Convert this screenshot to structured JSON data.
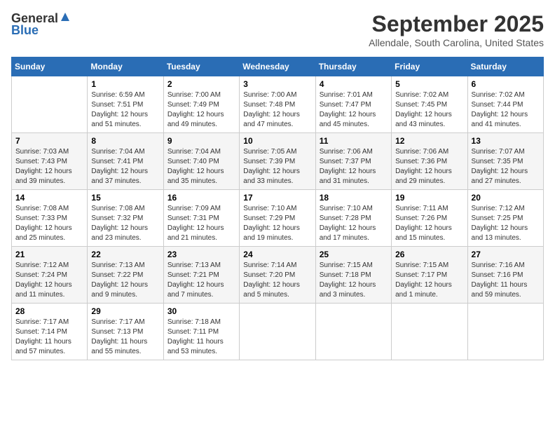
{
  "header": {
    "logo_general": "General",
    "logo_blue": "Blue",
    "month": "September 2025",
    "location": "Allendale, South Carolina, United States"
  },
  "weekdays": [
    "Sunday",
    "Monday",
    "Tuesday",
    "Wednesday",
    "Thursday",
    "Friday",
    "Saturday"
  ],
  "weeks": [
    [
      {
        "day": "",
        "info": ""
      },
      {
        "day": "1",
        "info": "Sunrise: 6:59 AM\nSunset: 7:51 PM\nDaylight: 12 hours\nand 51 minutes."
      },
      {
        "day": "2",
        "info": "Sunrise: 7:00 AM\nSunset: 7:49 PM\nDaylight: 12 hours\nand 49 minutes."
      },
      {
        "day": "3",
        "info": "Sunrise: 7:00 AM\nSunset: 7:48 PM\nDaylight: 12 hours\nand 47 minutes."
      },
      {
        "day": "4",
        "info": "Sunrise: 7:01 AM\nSunset: 7:47 PM\nDaylight: 12 hours\nand 45 minutes."
      },
      {
        "day": "5",
        "info": "Sunrise: 7:02 AM\nSunset: 7:45 PM\nDaylight: 12 hours\nand 43 minutes."
      },
      {
        "day": "6",
        "info": "Sunrise: 7:02 AM\nSunset: 7:44 PM\nDaylight: 12 hours\nand 41 minutes."
      }
    ],
    [
      {
        "day": "7",
        "info": "Sunrise: 7:03 AM\nSunset: 7:43 PM\nDaylight: 12 hours\nand 39 minutes."
      },
      {
        "day": "8",
        "info": "Sunrise: 7:04 AM\nSunset: 7:41 PM\nDaylight: 12 hours\nand 37 minutes."
      },
      {
        "day": "9",
        "info": "Sunrise: 7:04 AM\nSunset: 7:40 PM\nDaylight: 12 hours\nand 35 minutes."
      },
      {
        "day": "10",
        "info": "Sunrise: 7:05 AM\nSunset: 7:39 PM\nDaylight: 12 hours\nand 33 minutes."
      },
      {
        "day": "11",
        "info": "Sunrise: 7:06 AM\nSunset: 7:37 PM\nDaylight: 12 hours\nand 31 minutes."
      },
      {
        "day": "12",
        "info": "Sunrise: 7:06 AM\nSunset: 7:36 PM\nDaylight: 12 hours\nand 29 minutes."
      },
      {
        "day": "13",
        "info": "Sunrise: 7:07 AM\nSunset: 7:35 PM\nDaylight: 12 hours\nand 27 minutes."
      }
    ],
    [
      {
        "day": "14",
        "info": "Sunrise: 7:08 AM\nSunset: 7:33 PM\nDaylight: 12 hours\nand 25 minutes."
      },
      {
        "day": "15",
        "info": "Sunrise: 7:08 AM\nSunset: 7:32 PM\nDaylight: 12 hours\nand 23 minutes."
      },
      {
        "day": "16",
        "info": "Sunrise: 7:09 AM\nSunset: 7:31 PM\nDaylight: 12 hours\nand 21 minutes."
      },
      {
        "day": "17",
        "info": "Sunrise: 7:10 AM\nSunset: 7:29 PM\nDaylight: 12 hours\nand 19 minutes."
      },
      {
        "day": "18",
        "info": "Sunrise: 7:10 AM\nSunset: 7:28 PM\nDaylight: 12 hours\nand 17 minutes."
      },
      {
        "day": "19",
        "info": "Sunrise: 7:11 AM\nSunset: 7:26 PM\nDaylight: 12 hours\nand 15 minutes."
      },
      {
        "day": "20",
        "info": "Sunrise: 7:12 AM\nSunset: 7:25 PM\nDaylight: 12 hours\nand 13 minutes."
      }
    ],
    [
      {
        "day": "21",
        "info": "Sunrise: 7:12 AM\nSunset: 7:24 PM\nDaylight: 12 hours\nand 11 minutes."
      },
      {
        "day": "22",
        "info": "Sunrise: 7:13 AM\nSunset: 7:22 PM\nDaylight: 12 hours\nand 9 minutes."
      },
      {
        "day": "23",
        "info": "Sunrise: 7:13 AM\nSunset: 7:21 PM\nDaylight: 12 hours\nand 7 minutes."
      },
      {
        "day": "24",
        "info": "Sunrise: 7:14 AM\nSunset: 7:20 PM\nDaylight: 12 hours\nand 5 minutes."
      },
      {
        "day": "25",
        "info": "Sunrise: 7:15 AM\nSunset: 7:18 PM\nDaylight: 12 hours\nand 3 minutes."
      },
      {
        "day": "26",
        "info": "Sunrise: 7:15 AM\nSunset: 7:17 PM\nDaylight: 12 hours\nand 1 minute."
      },
      {
        "day": "27",
        "info": "Sunrise: 7:16 AM\nSunset: 7:16 PM\nDaylight: 11 hours\nand 59 minutes."
      }
    ],
    [
      {
        "day": "28",
        "info": "Sunrise: 7:17 AM\nSunset: 7:14 PM\nDaylight: 11 hours\nand 57 minutes."
      },
      {
        "day": "29",
        "info": "Sunrise: 7:17 AM\nSunset: 7:13 PM\nDaylight: 11 hours\nand 55 minutes."
      },
      {
        "day": "30",
        "info": "Sunrise: 7:18 AM\nSunset: 7:11 PM\nDaylight: 11 hours\nand 53 minutes."
      },
      {
        "day": "",
        "info": ""
      },
      {
        "day": "",
        "info": ""
      },
      {
        "day": "",
        "info": ""
      },
      {
        "day": "",
        "info": ""
      }
    ]
  ]
}
